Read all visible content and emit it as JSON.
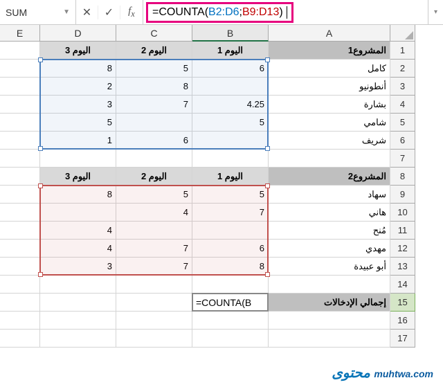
{
  "nameBox": "SUM",
  "formula": {
    "prefix": "=COUNTA(",
    "range1": "B2:D6",
    "sep": ";",
    "range2": "B9:D13",
    "suffix": ")"
  },
  "columns": [
    "A",
    "B",
    "C",
    "D",
    "E"
  ],
  "colWidths": {
    "A": 176,
    "B": 110,
    "C": 110,
    "D": 110,
    "E": 58
  },
  "rows": {
    "1": {
      "A": "المشروع1",
      "B": "اليوم 1",
      "C": "اليوم 2",
      "D": "اليوم 3"
    },
    "2": {
      "A": "كامل",
      "B": "6",
      "C": "5",
      "D": "8"
    },
    "3": {
      "A": "أنطونيو",
      "B": "",
      "C": "8",
      "D": "2"
    },
    "4": {
      "A": "بشارة",
      "B": "4.25",
      "C": "7",
      "D": "3"
    },
    "5": {
      "A": "شامي",
      "B": "5",
      "C": "",
      "D": "5"
    },
    "6": {
      "A": "شريف",
      "B": "",
      "C": "6",
      "D": "1"
    },
    "7": {},
    "8": {
      "A": "المشروع2",
      "B": "اليوم 1",
      "C": "اليوم 2",
      "D": "اليوم 3"
    },
    "9": {
      "A": "سهاد",
      "B": "5",
      "C": "5",
      "D": "8"
    },
    "10": {
      "A": "هاني",
      "B": "7",
      "C": "4",
      "D": ""
    },
    "11": {
      "A": "مُنح",
      "B": "",
      "C": "",
      "D": "4"
    },
    "12": {
      "A": "مهدي",
      "B": "6",
      "C": "7",
      "D": "4"
    },
    "13": {
      "A": "أبو عبيدة",
      "B": "8",
      "C": "7",
      "D": "3"
    },
    "14": {},
    "15": {
      "A": "إجمالي الإدخالات",
      "B": "=COUNTA(B"
    },
    "16": {},
    "17": {}
  },
  "activeRow": 15,
  "watermark": "muhtwa محتوى .com"
}
